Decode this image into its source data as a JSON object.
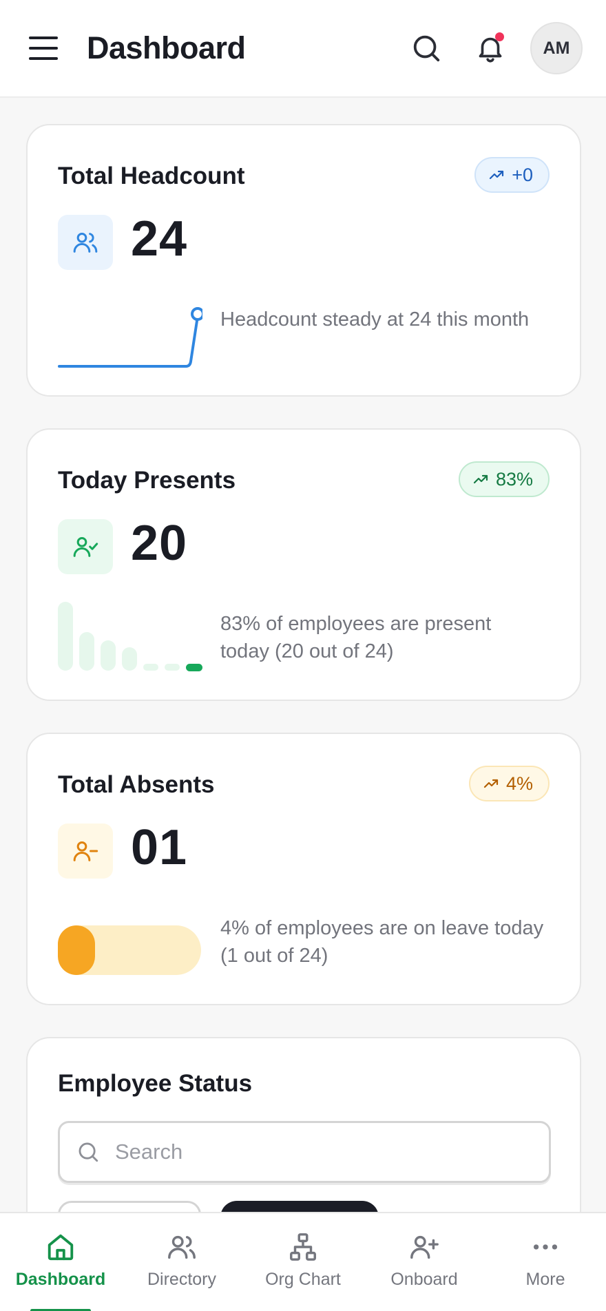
{
  "header": {
    "title": "Dashboard",
    "avatar_initials": "AM",
    "menu_icon": "menu-icon",
    "search_icon": "search-icon",
    "notification_icon": "bell-icon",
    "has_unread_notifications": true
  },
  "cards": {
    "headcount": {
      "title": "Total Headcount",
      "value": "24",
      "badge": "+0",
      "description": "Headcount steady at 24 this month",
      "icon": "users-icon",
      "accent": "#2f86e0"
    },
    "presents": {
      "title": "Today Presents",
      "value": "20",
      "badge": "83%",
      "description": "83% of employees are present today (20 out of 24)",
      "icon": "user-check-icon",
      "accent": "#17a85a"
    },
    "absents": {
      "title": "Total Absents",
      "value": "01",
      "badge": "4%",
      "description": "4% of employees are on leave today (1 out of 24)",
      "icon": "user-minus-icon",
      "accent": "#f6a623",
      "leave_fraction": 0.04
    }
  },
  "employee_status": {
    "title": "Employee Status",
    "search_placeholder": "Search"
  },
  "bottom_nav": {
    "items": [
      {
        "label": "Dashboard",
        "icon": "home-icon",
        "active": true
      },
      {
        "label": "Directory",
        "icon": "users-icon",
        "active": false
      },
      {
        "label": "Org Chart",
        "icon": "org-chart-icon",
        "active": false
      },
      {
        "label": "Onboard",
        "icon": "user-plus-icon",
        "active": false
      },
      {
        "label": "More",
        "icon": "more-icon",
        "active": false
      }
    ]
  }
}
